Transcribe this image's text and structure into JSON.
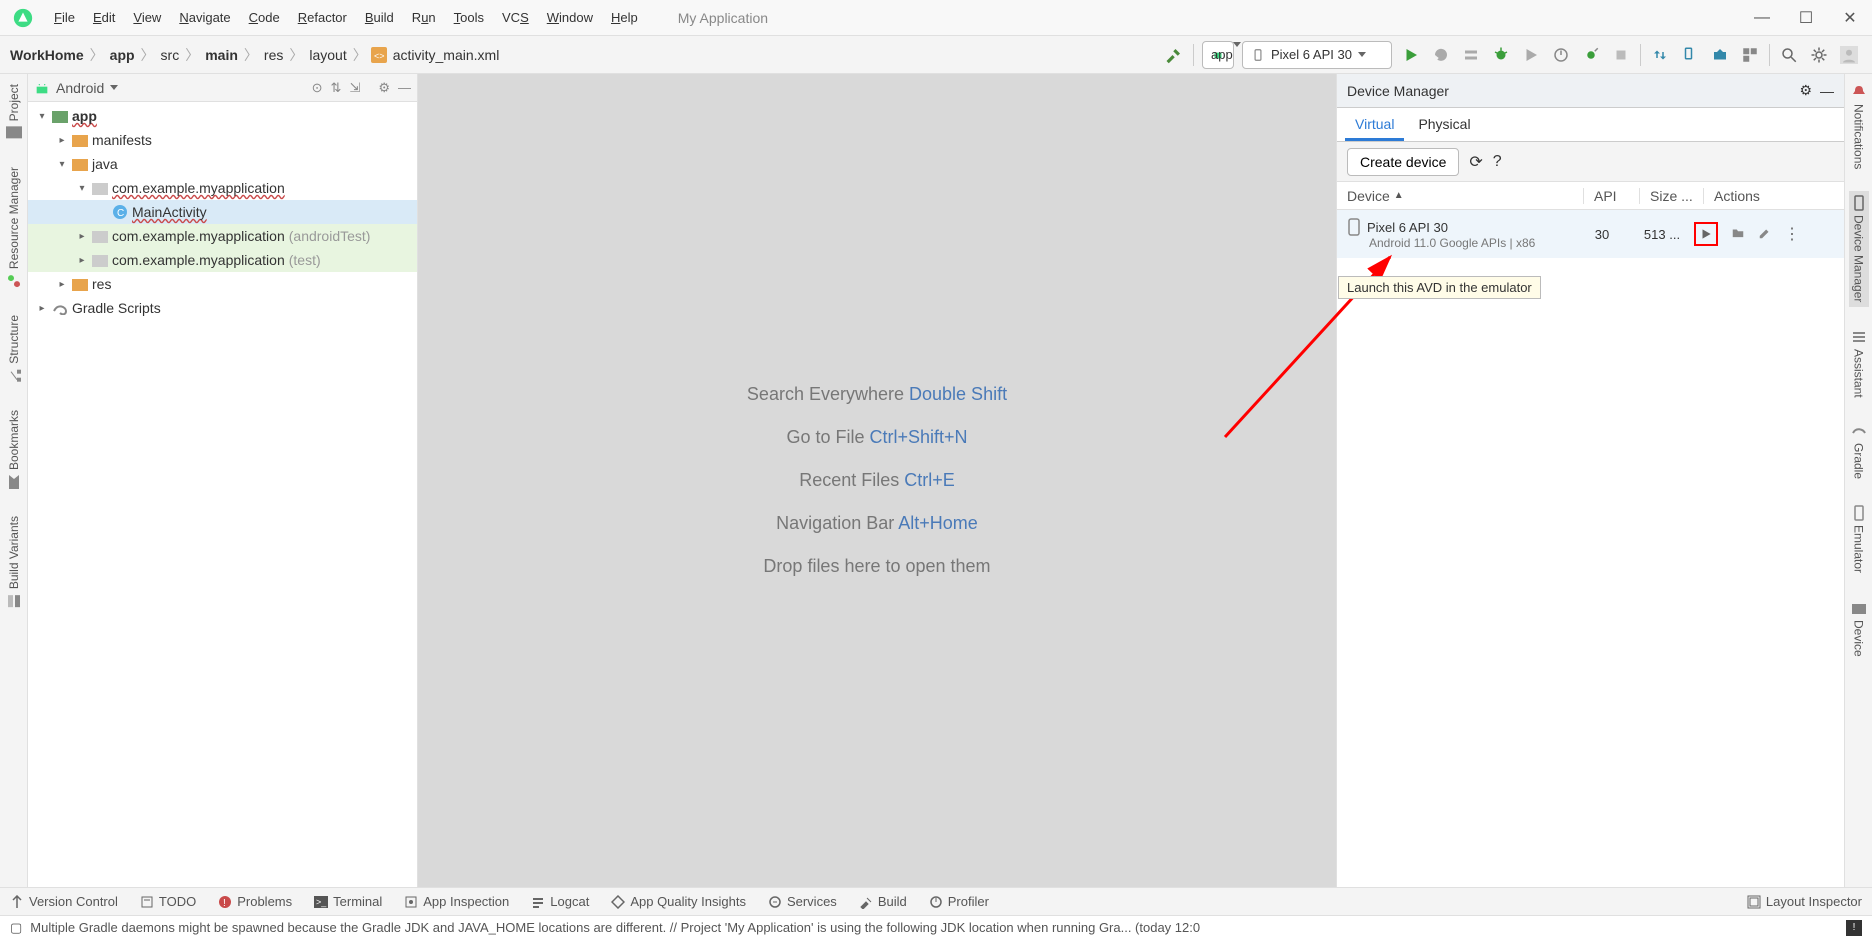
{
  "app": {
    "title": "My Application"
  },
  "menu": {
    "file": "File",
    "edit": "Edit",
    "view": "View",
    "navigate": "Navigate",
    "code": "Code",
    "refactor": "Refactor",
    "build": "Build",
    "run": "Run",
    "tools": "Tools",
    "vcs": "VCS",
    "window": "Window",
    "help": "Help"
  },
  "breadcrumb": {
    "root": "WorkHome",
    "app": "app",
    "src": "src",
    "main": "main",
    "res": "res",
    "layout": "layout",
    "file": "activity_main.xml"
  },
  "toolbar": {
    "runconfig": "app",
    "device": "Pixel 6 API 30"
  },
  "projectDropdown": "Android",
  "tree": {
    "app": "app",
    "manifests": "manifests",
    "java": "java",
    "pkg": "com.example.myapplication",
    "mainActivity": "MainActivity",
    "pkg2": "com.example.myapplication",
    "pkg2_suffix": "(androidTest)",
    "pkg3": "com.example.myapplication",
    "pkg3_suffix": "(test)",
    "res": "res",
    "gradle": "Gradle Scripts"
  },
  "editor": {
    "l1": "Search Everywhere",
    "s1": "Double Shift",
    "l2": "Go to File",
    "s2": "Ctrl+Shift+N",
    "l3": "Recent Files",
    "s3": "Ctrl+E",
    "l4": "Navigation Bar",
    "s4": "Alt+Home",
    "l5": "Drop files here to open them"
  },
  "devmgr": {
    "title": "Device Manager",
    "tab1": "Virtual",
    "tab2": "Physical",
    "createBtn": "Create device",
    "colDevice": "Device",
    "colApi": "API",
    "colSize": "Size ...",
    "colActions": "Actions",
    "rowName": "Pixel 6 API 30",
    "rowSub": "Android 11.0 Google APIs | x86",
    "rowApi": "30",
    "rowSize": "513 ...",
    "tooltip": "Launch this AVD in the emulator"
  },
  "sidetabs": {
    "left1": "Project",
    "left2": "Resource Manager",
    "left3": "Structure",
    "left4": "Bookmarks",
    "left5": "Build Variants",
    "right1": "Notifications",
    "right2": "Device Manager",
    "right3": "Assistant",
    "right4": "Gradle",
    "right5": "Emulator",
    "right6": "Device"
  },
  "bottom": {
    "b1": "Version Control",
    "b2": "TODO",
    "b3": "Problems",
    "b4": "Terminal",
    "b5": "App Inspection",
    "b6": "Logcat",
    "b7": "App Quality Insights",
    "b8": "Services",
    "b9": "Build",
    "b10": "Profiler",
    "b11": "Layout Inspector"
  },
  "status": {
    "msg": "Multiple Gradle daemons might be spawned because the Gradle JDK and JAVA_HOME locations are different. // Project 'My Application' is using the following JDK location when running Gra... (today 12:0"
  }
}
